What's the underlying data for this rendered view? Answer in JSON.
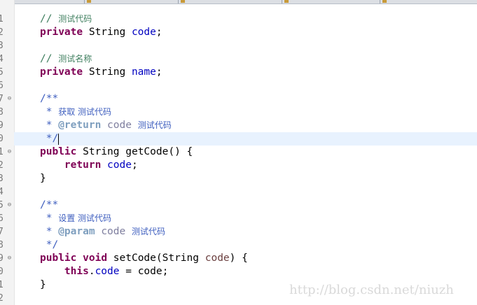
{
  "tabs": [
    "",
    "",
    "",
    "",
    ""
  ],
  "line_numbers": [
    "1",
    "2",
    "3",
    "4",
    "5",
    "6",
    "7",
    "8",
    "9",
    "0",
    "1",
    "2",
    "3",
    "4",
    "5",
    "6",
    "7",
    "8",
    "9",
    "0",
    "1",
    "2"
  ],
  "fold_markers": [
    "⊖",
    "⊖",
    "⊖",
    "⊖"
  ],
  "code": {
    "l1": {
      "comment_slashes": "// ",
      "comment_text": "测试代码"
    },
    "l2": {
      "kw": "private",
      "type": " String ",
      "field": "code",
      "end": ";"
    },
    "l4": {
      "comment_slashes": "// ",
      "comment_text": "测试名称"
    },
    "l5": {
      "kw": "private",
      "type": " String ",
      "field": "name",
      "end": ";"
    },
    "l7": {
      "jd": "/**"
    },
    "l8": {
      "jd_star": " * ",
      "jd_text": "获取 测试代码"
    },
    "l9": {
      "jd_star": " * ",
      "tag": "@return",
      "sp": " ",
      "id": "code",
      "sp2": " ",
      "jd_text": "测试代码"
    },
    "l10": {
      "jd": " */"
    },
    "l11": {
      "kw": "public",
      "rest": " String getCode() {"
    },
    "l12": {
      "indent": "    ",
      "kw": "return",
      "sp": " ",
      "field": "code",
      "end": ";"
    },
    "l13": {
      "text": "}"
    },
    "l15": {
      "jd": "/**"
    },
    "l16": {
      "jd_star": " * ",
      "jd_text": "设置 测试代码"
    },
    "l17": {
      "jd_star": " * ",
      "tag": "@param",
      "sp": " ",
      "id": "code",
      "sp2": " ",
      "jd_text": "测试代码"
    },
    "l18": {
      "jd": " */"
    },
    "l19": {
      "kw1": "public",
      "sp": " ",
      "kw2": "void",
      "rest": " setCode(String ",
      "param": "code",
      "end": ") {"
    },
    "l20": {
      "indent": "    ",
      "kw": "this",
      "dot": ".",
      "field": "code",
      "rest": " = code;"
    },
    "l21": {
      "text": "}"
    }
  },
  "watermark": "http://blog.csdn.net/niuzh"
}
